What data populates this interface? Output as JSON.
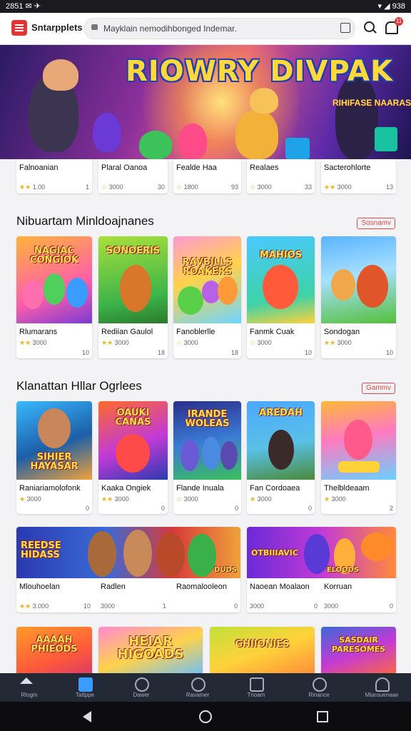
{
  "status": {
    "left": "2851  ✉  ✈",
    "right": "▾ ◢ 938"
  },
  "browser": {
    "site": "Sntarpplets",
    "url": "Mayklain nemodihbonged Indemar.",
    "badge": "11"
  },
  "hero": {
    "title": "RIOWRY DIVPAK",
    "subtitle": "RIHIFASE NAARAS"
  },
  "top_row": [
    {
      "name": "Falnoanian",
      "rating": "1.00",
      "stars": "★★",
      "count": "1"
    },
    {
      "name": "Plaral Oanoa",
      "rating": "3000",
      "stars": "☆",
      "count": "30"
    },
    {
      "name": "Fealde Haa",
      "rating": "1800",
      "stars": "☆",
      "count": "93"
    },
    {
      "name": "Realaes",
      "rating": "3000",
      "stars": "☆",
      "count": "33"
    },
    {
      "name": "Sacterohlorte",
      "rating": "3000",
      "stars": "★★",
      "count": "13"
    }
  ],
  "section1": {
    "title": "Nibuartam Minldoajnanes",
    "button": "Sosnamv",
    "items": [
      {
        "thumb": "NAGIAC CONGIOK",
        "name": "Rlumarans",
        "rating": "3000",
        "stars": "★★",
        "count": "10"
      },
      {
        "thumb": "SONOERIS",
        "name": "Rediian Gaulol",
        "rating": "3000",
        "stars": "★★",
        "count": "18"
      },
      {
        "thumb": "RAVBILLS ROAKERS",
        "name": "Fanoblerlle",
        "rating": "3000",
        "stars": "☆",
        "count": "18"
      },
      {
        "thumb": "MAHIOS",
        "name": "Fanmk Cuak",
        "rating": "3000",
        "stars": "☆",
        "count": "10"
      },
      {
        "thumb": "",
        "name": "Sondogan",
        "rating": "3000",
        "stars": "★★",
        "count": "10"
      }
    ]
  },
  "section2": {
    "title": "Klanattan Hllar Ogrlees",
    "button": "Gammv",
    "items": [
      {
        "thumb": "SIHIER HAYASAR",
        "name": "Raniariamolofonk",
        "rating": "3000",
        "stars": "★",
        "count": "0"
      },
      {
        "thumb": "OAUKI CANAS",
        "name": "Kaaka Ongiek",
        "rating": "3000",
        "stars": "★★",
        "count": "0"
      },
      {
        "thumb": "IRANDE WOLEAS",
        "name": "Flande Inuala",
        "rating": "3000",
        "stars": "☆",
        "count": "0"
      },
      {
        "thumb": "AREDAH",
        "name": "Fan Cordoaea",
        "rating": "3000",
        "stars": "★",
        "count": "0"
      },
      {
        "thumb": "",
        "name": "Thelbldeaam",
        "rating": "3000",
        "stars": "★",
        "count": "2"
      }
    ]
  },
  "wide_row": [
    {
      "thumb": "REEDSE HIDASS",
      "badge": "DUDS",
      "name": "Mlouhoelan",
      "rating": "3.000",
      "stars": "★★",
      "count": "10"
    },
    {
      "thumb": "Radlen",
      "name": "Radlen",
      "rating": "3000",
      "stars": "",
      "count": "1"
    },
    {
      "thumb": "",
      "name": "Raomalooleon",
      "rating": "",
      "stars": "",
      "count": "0"
    },
    {
      "thumb": "OTBIIIAVIC",
      "badge": "ELOODS",
      "name": "Naoean Moalaon",
      "rating": "3000",
      "stars": "",
      "count": "0"
    },
    {
      "thumb": "",
      "name": "Korruan",
      "rating": "3000",
      "stars": "",
      "count": "0"
    }
  ],
  "bottom_row": [
    {
      "thumb": "AAAAH PHIEODS"
    },
    {
      "thumb": "HEIAR HIGOADS"
    },
    {
      "thumb": "GHIIONIES"
    },
    {
      "thumb": "SASDAIR PARESOMES"
    }
  ],
  "nav": [
    {
      "label": "Rlogm",
      "icon": "home-icon",
      "active": false
    },
    {
      "label": "Tattppe",
      "icon": "store-icon",
      "active": true
    },
    {
      "label": "Dawer",
      "icon": "globe-icon",
      "active": false
    },
    {
      "label": "Ravamer",
      "icon": "search-icon",
      "active": false
    },
    {
      "label": "Tnoam",
      "icon": "chart-icon",
      "active": false
    },
    {
      "label": "Rinance",
      "icon": "search-icon",
      "active": false
    },
    {
      "label": "Mlarouenaae",
      "icon": "user-icon",
      "active": false
    }
  ],
  "colors": {
    "accent": "#e03636",
    "nav_bg": "#232a36",
    "active": "#3b9bff",
    "star": "#f2b21b"
  }
}
